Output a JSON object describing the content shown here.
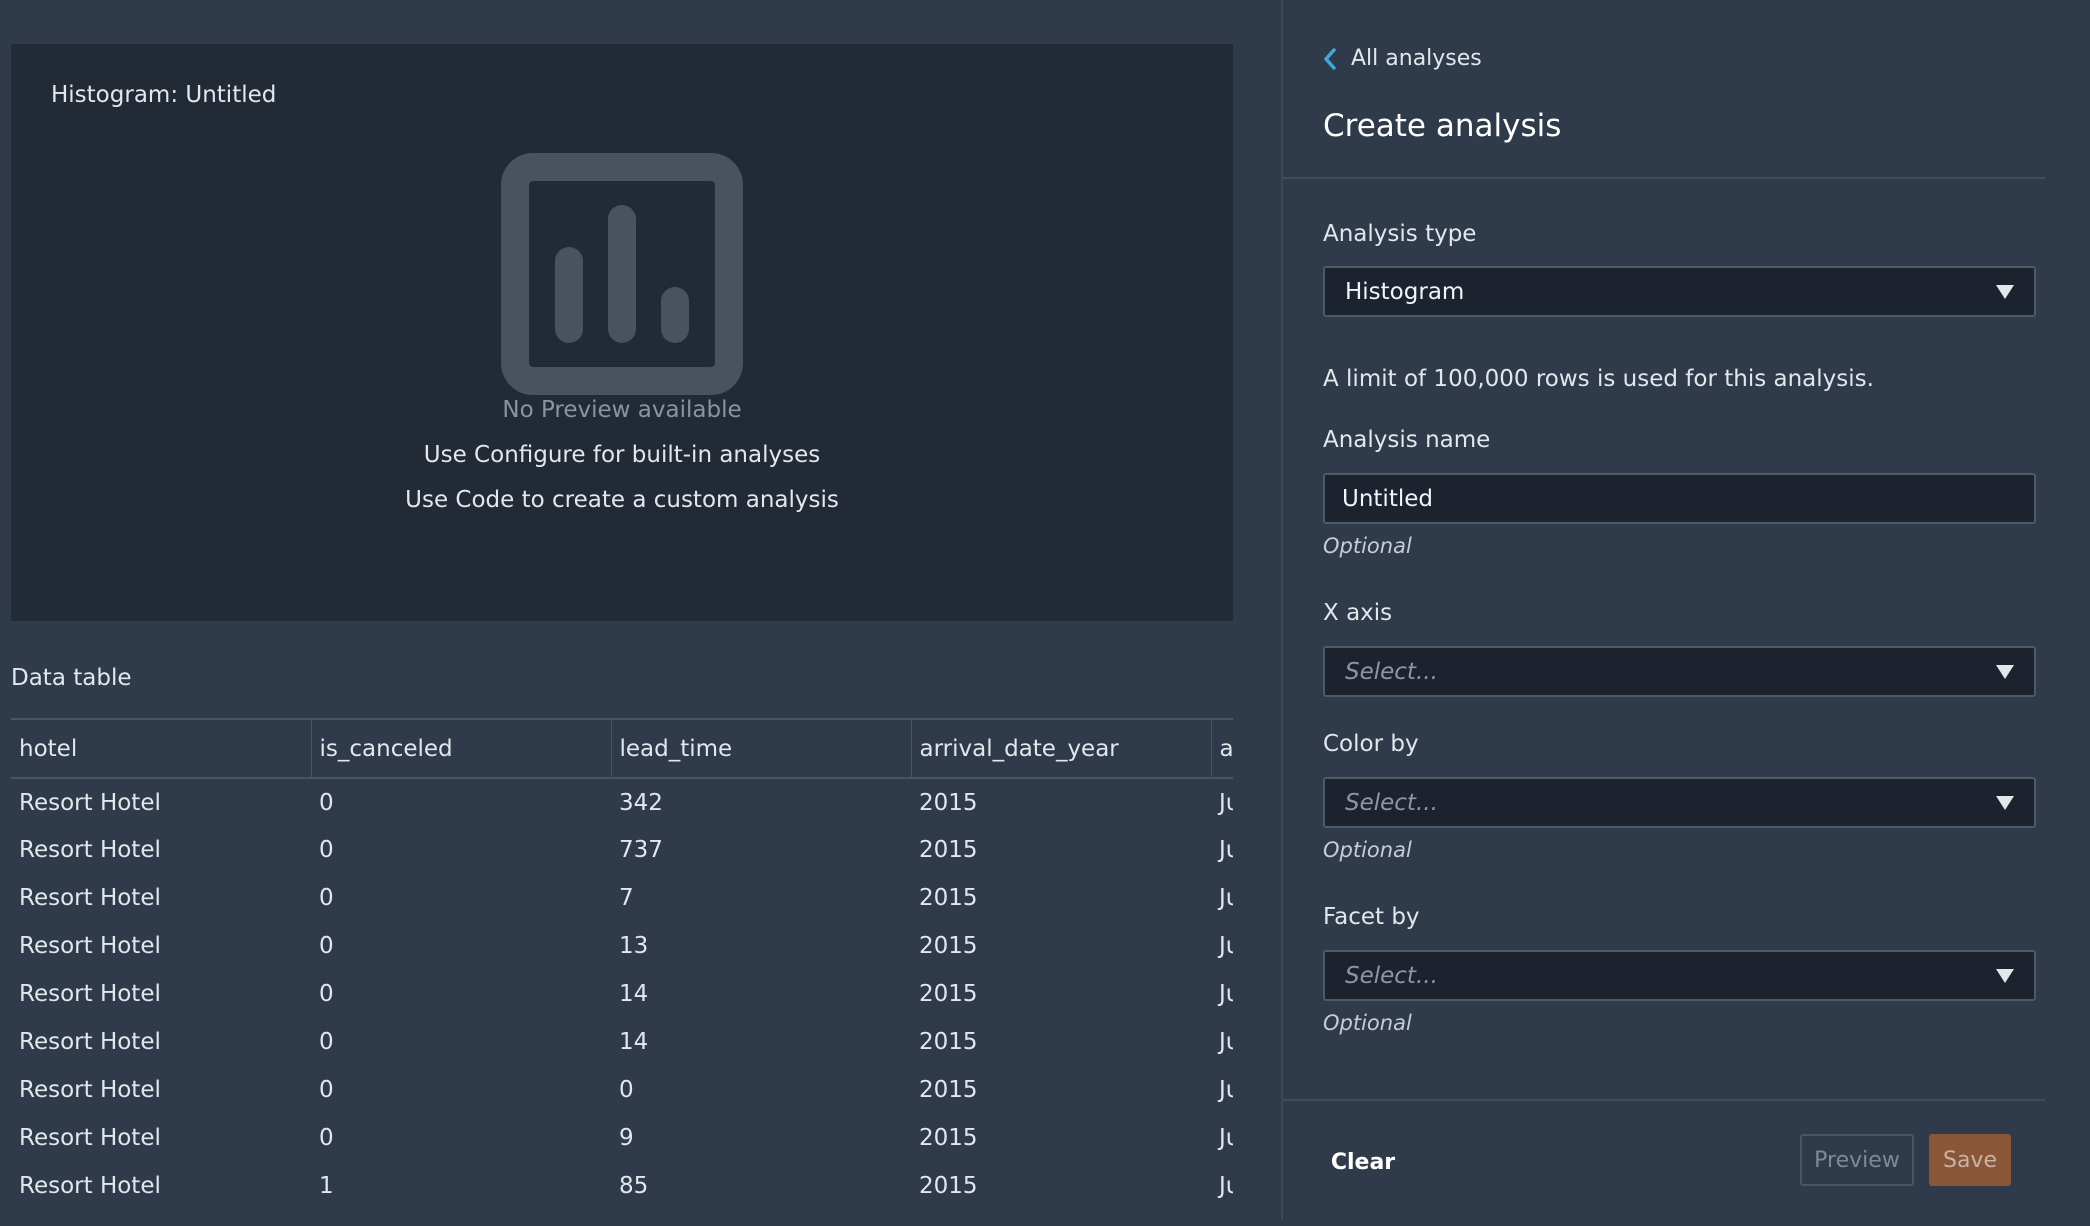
{
  "preview": {
    "title": "Histogram: Untitled",
    "icon": "bar-chart-placeholder-icon",
    "no_preview": "No Preview available",
    "hint_configure": "Use Configure for built-in analyses",
    "hint_code": "Use Code to create a custom analysis"
  },
  "data_table": {
    "title": "Data table",
    "columns": [
      "hotel",
      "is_canceled",
      "lead_time",
      "arrival_date_year",
      "a"
    ],
    "rows": [
      [
        "Resort Hotel",
        "0",
        "342",
        "2015",
        "Ju"
      ],
      [
        "Resort Hotel",
        "0",
        "737",
        "2015",
        "Ju"
      ],
      [
        "Resort Hotel",
        "0",
        "7",
        "2015",
        "Ju"
      ],
      [
        "Resort Hotel",
        "0",
        "13",
        "2015",
        "Ju"
      ],
      [
        "Resort Hotel",
        "0",
        "14",
        "2015",
        "Ju"
      ],
      [
        "Resort Hotel",
        "0",
        "14",
        "2015",
        "Ju"
      ],
      [
        "Resort Hotel",
        "0",
        "0",
        "2015",
        "Ju"
      ],
      [
        "Resort Hotel",
        "0",
        "9",
        "2015",
        "Ju"
      ],
      [
        "Resort Hotel",
        "1",
        "85",
        "2015",
        "Ju"
      ]
    ]
  },
  "panel": {
    "back_label": "All analyses",
    "title": "Create analysis",
    "analysis_type": {
      "label": "Analysis type",
      "value": "Histogram"
    },
    "limit_note": "A limit of 100,000 rows is used for this analysis.",
    "analysis_name": {
      "label": "Analysis name",
      "value": "Untitled",
      "hint": "Optional"
    },
    "x_axis": {
      "label": "X axis",
      "placeholder": "Select..."
    },
    "color_by": {
      "label": "Color by",
      "placeholder": "Select...",
      "hint": "Optional"
    },
    "facet_by": {
      "label": "Facet by",
      "placeholder": "Select...",
      "hint": "Optional"
    },
    "buttons": {
      "clear": "Clear",
      "preview": "Preview",
      "save": "Save"
    }
  },
  "colors": {
    "background": "#2f3a4a",
    "card": "#222a36",
    "input_bg": "#1c232e",
    "save_button": "#8a5638",
    "link_chevron": "#3fa9d8"
  }
}
